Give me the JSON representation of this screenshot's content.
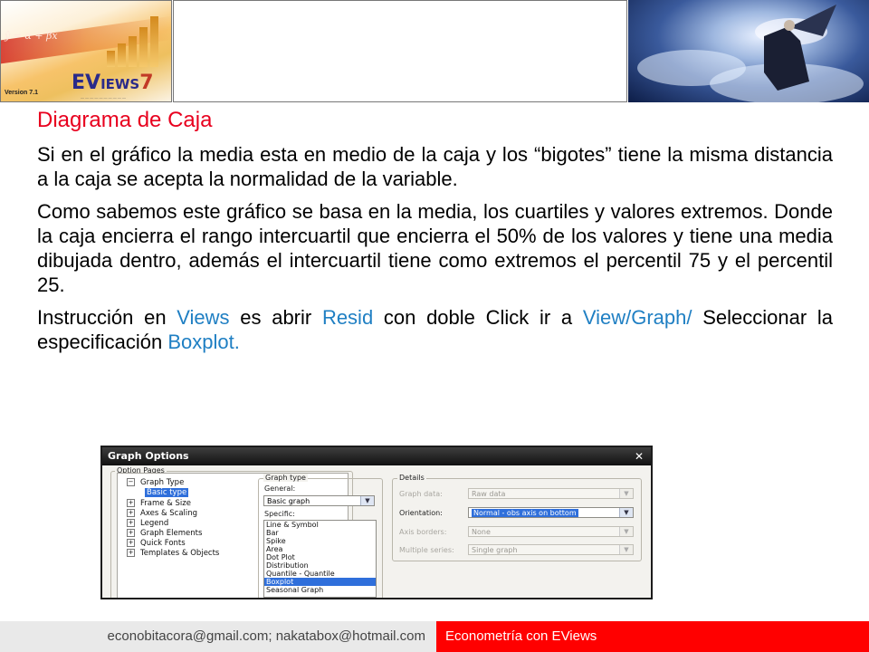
{
  "header": {
    "logo_wordmark_a": "EV",
    "logo_wordmark_b": "IEWS",
    "logo_wordmark_c": "7",
    "logo_version": "Version 7.1"
  },
  "slide": {
    "title": "Diagrama de Caja",
    "paragraph1": "Si en el gráfico la media esta en medio de la caja y los “bigotes” tiene la misma distancia a la caja se acepta la normalidad de la variable.",
    "paragraph2": "Como sabemos este gráfico se basa en la media, los cuartiles y valores extremos. Donde la caja encierra el rango intercuartil que encierra el 50% de los valores y tiene una media dibujada dentro, además el intercuartil tiene como extremos el percentil 75 y el percentil 25.",
    "instr": {
      "t1": "Instrucción en ",
      "k1": "Views",
      "t2": " es abrir ",
      "k2": "Resid",
      "t3": " con doble Click ir a ",
      "k3": "View/Graph/",
      "t4": " Seleccionar la especificación ",
      "k4": "Boxplot."
    },
    "accent_color": "#e8001e",
    "keyword_color": "#1f7fc3"
  },
  "dialog": {
    "title": "Graph Options",
    "close": "✕",
    "option_pages_label": "Option Pages",
    "tree": [
      {
        "sign": "−",
        "label": "Graph Type"
      },
      {
        "sign": "",
        "label": "Basic type",
        "selected": true
      },
      {
        "sign": "+",
        "label": "Frame & Size"
      },
      {
        "sign": "+",
        "label": "Axes & Scaling"
      },
      {
        "sign": "+",
        "label": "Legend"
      },
      {
        "sign": "+",
        "label": "Graph Elements"
      },
      {
        "sign": "+",
        "label": "Quick Fonts"
      },
      {
        "sign": "+",
        "label": "Templates & Objects"
      }
    ],
    "graph_type_label": "Graph type",
    "general_label": "General:",
    "general_value": "Basic graph",
    "specific_label": "Specific:",
    "specific_items": [
      "Line & Symbol",
      "Bar",
      "Spike",
      "Area",
      "Dot Plot",
      "Distribution",
      "Quantile - Quantile",
      "Boxplot",
      "Seasonal Graph"
    ],
    "specific_selected": "Boxplot",
    "details_label": "Details",
    "details": [
      {
        "label": "Graph data:",
        "value": "Raw data",
        "enabled": false
      },
      {
        "label": "Orientation:",
        "value": "Normal - obs axis on bottom",
        "enabled": true
      },
      {
        "label": "Axis borders:",
        "value": "None",
        "enabled": false
      },
      {
        "label": "Multiple series:",
        "value": "Single graph",
        "enabled": false
      }
    ]
  },
  "footer": {
    "emails": "econobitacora@gmail.com;  nakatabox@hotmail.com",
    "course": "Econometría con EViews"
  }
}
